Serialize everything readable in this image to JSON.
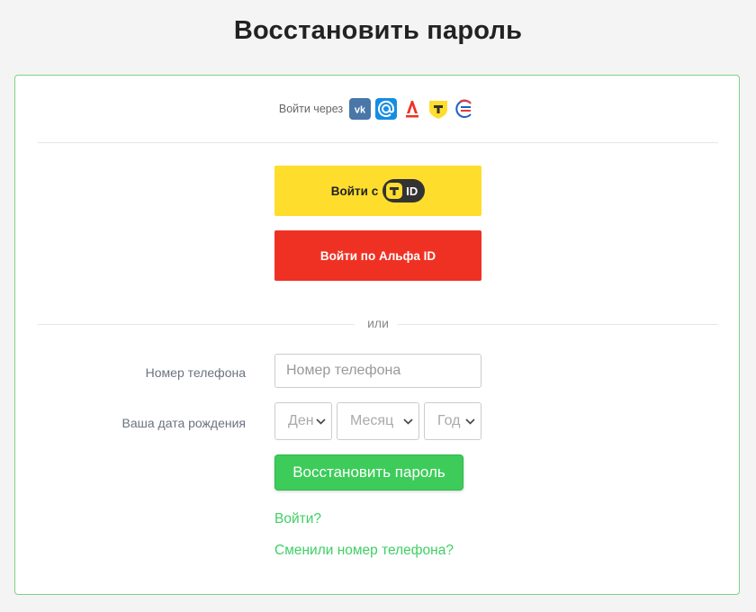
{
  "page": {
    "title": "Восстановить пароль"
  },
  "social": {
    "label": "Войти через",
    "icons": [
      "vk-icon",
      "mail-ru-icon",
      "alfa-icon",
      "tinkoff-icon",
      "gosuslugi-icon"
    ]
  },
  "buttons": {
    "tid_prefix": "Войти с",
    "tid_badge": "ID",
    "alfa": "Войти по Альфа ID",
    "restore": "Восстановить пароль"
  },
  "divider": {
    "or": "или"
  },
  "form": {
    "phone_label": "Номер телефона",
    "phone_placeholder": "Номер телефона",
    "phone_value": "",
    "birth_label": "Ваша дата рождения",
    "day_placeholder": "День",
    "month_placeholder": "Месяц",
    "year_placeholder": "Год"
  },
  "links": {
    "login": "Войти?",
    "changed_phone": "Сменили номер телефона?"
  },
  "colors": {
    "accent_green": "#3dcc5a",
    "tid_yellow": "#ffdd2d",
    "alfa_red": "#ef3124",
    "vk_blue": "#4a76a8",
    "mail_blue": "#168de2"
  }
}
